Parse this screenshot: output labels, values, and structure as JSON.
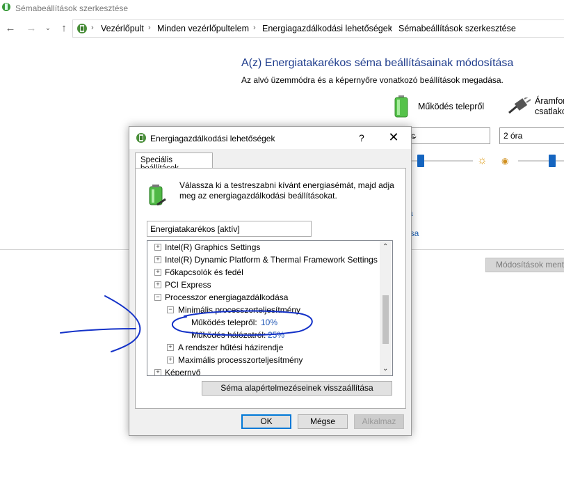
{
  "window": {
    "title": "Sémabeállítások szerkesztése"
  },
  "address": {
    "crumbs": [
      "Vezérlőpult",
      "Minden vezérlőpultelem",
      "Energiagazdálkodási lehetőségek",
      "Sémabeállítások szerkesztése"
    ]
  },
  "page": {
    "heading": "A(z) Energiatakarékos séma beállításainak módosítása",
    "subheading": "Az alvó üzemmódra és a képernyőre vonatkozó beállítások megadása.",
    "battery_label": "Működés telepről",
    "ac_label_line1": "Áramforr",
    "ac_label_line2": "csatlakoz",
    "select_battery_value": "c",
    "select_ac_value": "2 óra",
    "link1": "a",
    "link2": "isa",
    "save_changes": "Módosítások menté"
  },
  "dialog": {
    "title": "Energiagazdálkodási lehetőségek",
    "help": "?",
    "close": "✕",
    "tab": "Speciális beállítások",
    "instruction": "Válassza ki a testreszabni kívánt energiasémát, majd adja meg az energiagazdálkodási beállításokat.",
    "scheme_value": "Energiatakarékos [aktív]",
    "tree": [
      {
        "label": "Intel(R) Graphics Settings",
        "toggle": "+"
      },
      {
        "label": "Intel(R) Dynamic Platform & Thermal Framework Settings",
        "toggle": "+"
      },
      {
        "label": "Főkapcsolók és fedél",
        "toggle": "+"
      },
      {
        "label": "PCI Express",
        "toggle": "+"
      },
      {
        "label": "Processzor energiagazdálkodása",
        "toggle": "−"
      },
      {
        "label": "Minimális processzorteljesítmény",
        "toggle": "−"
      },
      {
        "label": "Működés telepről:",
        "value": "10%"
      },
      {
        "label": "Működés hálózatról:",
        "value": "25%"
      },
      {
        "label": "A rendszer hűtési házirendje",
        "toggle": "+"
      },
      {
        "label": "Maximális processzorteljesítmény",
        "toggle": "+"
      },
      {
        "label": "Képernyő",
        "toggle": "+"
      }
    ],
    "restore_button": "Séma alapértelmezéseinek visszaállítása",
    "ok": "OK",
    "cancel": "Mégse",
    "apply": "Alkalmaz"
  },
  "colors": {
    "accent": "#0078d7",
    "link": "#1e55b4",
    "heading": "#1e3c8c",
    "annotation_ink": "#1432c8"
  },
  "icons": [
    "back-arrow-icon",
    "forward-arrow-icon",
    "chevron-down-icon",
    "up-arrow-icon",
    "control-panel-icon",
    "battery-icon",
    "plug-icon",
    "brightness-icon"
  ]
}
